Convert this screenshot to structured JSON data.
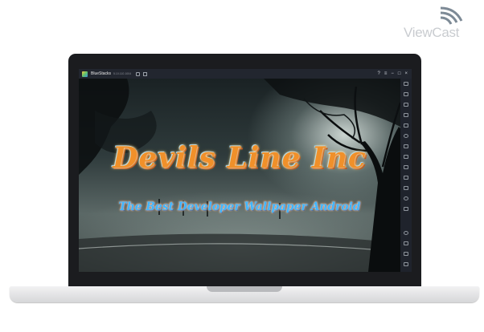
{
  "watermark": {
    "brand": "ViewCast",
    "icon": "wifi-waves-icon"
  },
  "window": {
    "app_name": "BlueStacks",
    "app_version": "5.10.110.1004",
    "title_icons": [
      "home-icon",
      "multi-instance-icon"
    ],
    "controls": [
      "help-icon",
      "menu-icon",
      "minimize-icon",
      "maximize-icon",
      "close-icon"
    ]
  },
  "sidebar": {
    "icons": [
      "fullscreen-icon",
      "volume-up-icon",
      "volume-down-icon",
      "screen-record-icon",
      "keyboard-icon",
      "rotate-icon",
      "shake-icon",
      "screenshot-icon",
      "folder-icon",
      "apk-install-icon",
      "copy-icon",
      "eco-mode-icon",
      "macro-icon",
      "settings-icon",
      "back-icon",
      "home-nav-icon",
      "recents-icon"
    ]
  },
  "wallpaper": {
    "title": "Devils Line Inc",
    "subtitle": "The Best Developer Wallpaper Android"
  }
}
